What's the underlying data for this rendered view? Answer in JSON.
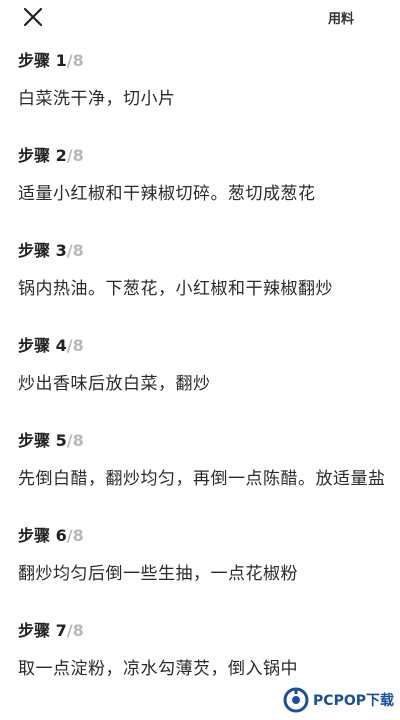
{
  "header": {
    "close_icon": "close-icon",
    "ingredients_label": "用料"
  },
  "steps": [
    {
      "label": "步骤 1",
      "total": "/8",
      "text": "白菜洗干净，切小片"
    },
    {
      "label": "步骤 2",
      "total": "/8",
      "text": "适量小红椒和干辣椒切碎。葱切成葱花"
    },
    {
      "label": "步骤 3",
      "total": "/8",
      "text": "锅内热油。下葱花，小红椒和干辣椒翻炒"
    },
    {
      "label": "步骤 4",
      "total": "/8",
      "text": "炒出香味后放白菜，翻炒"
    },
    {
      "label": "步骤 5",
      "total": "/8",
      "text": "先倒白醋，翻炒均匀，再倒一点陈醋。放适量盐"
    },
    {
      "label": "步骤 6",
      "total": "/8",
      "text": "翻炒均匀后倒一些生抽，一点花椒粉"
    },
    {
      "label": "步骤 7",
      "total": "/8",
      "text": "取一点淀粉，凉水勾薄芡，倒入锅中"
    }
  ],
  "watermark": {
    "text": "PCPOP下载"
  },
  "colors": {
    "accent": "#1a4f9c",
    "step_total": "#b8b8b8",
    "text": "#2a2a2a"
  }
}
